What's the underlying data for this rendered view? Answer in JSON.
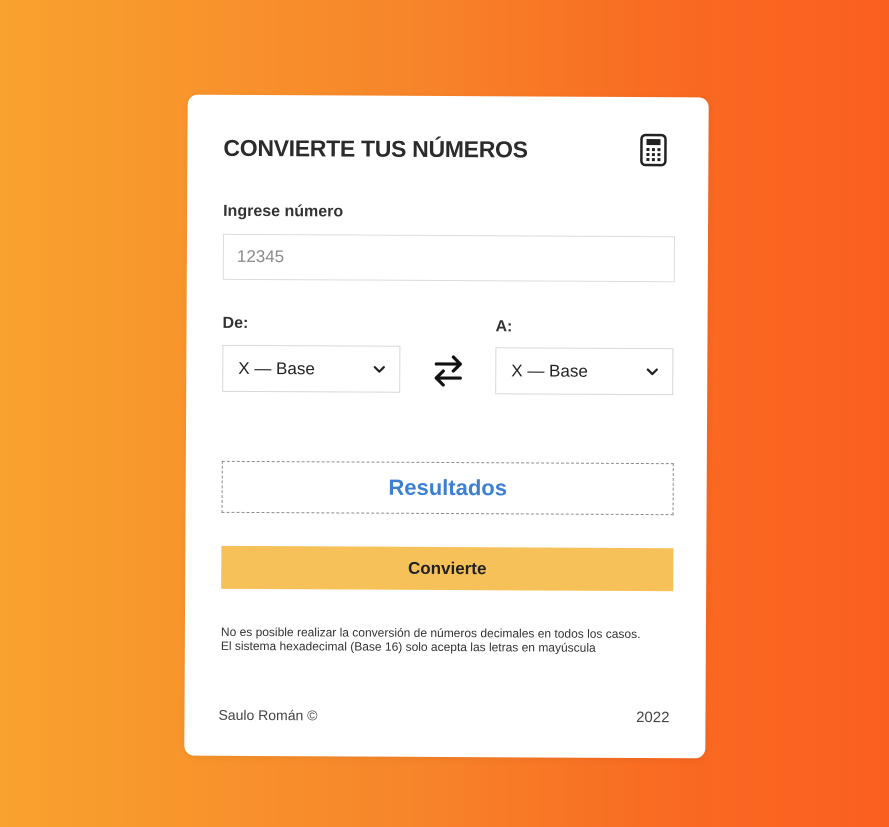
{
  "card": {
    "title": "CONVIERTE TUS NÚMEROS",
    "icon": "calculator-icon"
  },
  "form": {
    "number_label": "Ingrese número",
    "number_placeholder": "12345",
    "from_label": "De:",
    "to_label": "A:",
    "from_selected": "X — Base",
    "to_selected": "X — Base",
    "swap_icon": "swap-arrows-icon",
    "results_label": "Resultados",
    "convert_label": "Convierte"
  },
  "notes": {
    "line1": "No es posible realizar la conversión de números decimales en todos los casos.",
    "line2": "El sistema hexadecimal (Base 16) solo acepta las letras en mayúscula"
  },
  "footer": {
    "author": "Saulo Román ©",
    "year": "2022"
  },
  "colors": {
    "background_start": "#f9a22e",
    "background_end": "#fb5f1f",
    "results_text": "#3d7fd1",
    "button_bg": "#f7c15a"
  }
}
